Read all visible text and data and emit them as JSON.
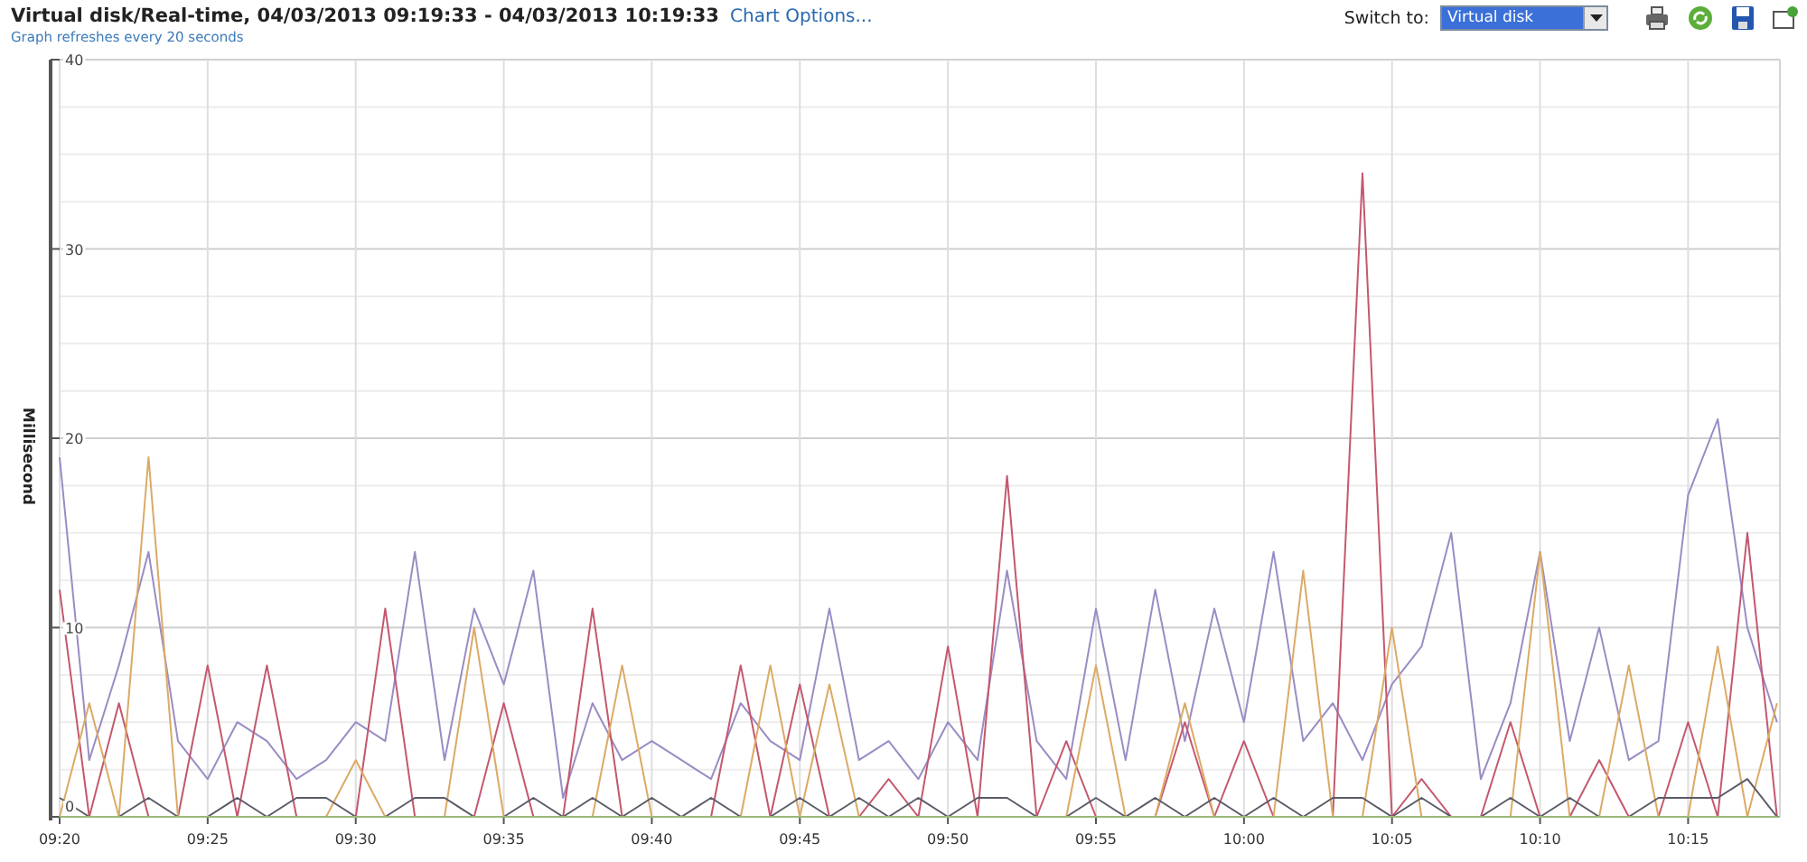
{
  "header": {
    "title": "Virtual disk/Real-time, 04/03/2013 09:19:33 - 04/03/2013 10:19:33",
    "chart_options_link": "Chart Options...",
    "subtitle": "Graph refreshes every 20 seconds",
    "switch_label": "Switch to:",
    "switch_value": "Virtual disk"
  },
  "chart": {
    "chart_data": {
      "type": "line",
      "ylabel": "Millisecond",
      "categories": [
        "09:20",
        null,
        null,
        null,
        null,
        "09:25",
        null,
        null,
        null,
        null,
        "09:30",
        null,
        null,
        null,
        null,
        "09:35",
        null,
        null,
        null,
        null,
        "09:40",
        null,
        null,
        null,
        null,
        "09:45",
        null,
        null,
        null,
        null,
        "09:50",
        null,
        null,
        null,
        null,
        "09:55",
        null,
        null,
        null,
        null,
        "10:00",
        null,
        null,
        null,
        null,
        "10:05",
        null,
        null,
        null,
        null,
        "10:10",
        null,
        null,
        null,
        null,
        "10:15",
        null,
        null,
        null
      ],
      "ylim": [
        0,
        40
      ],
      "grid": true,
      "yticks": [
        0,
        10,
        20,
        30,
        40
      ],
      "series": [
        {
          "color": "#9a8cc4",
          "values": [
            19,
            3,
            8,
            14,
            4,
            2,
            5,
            4,
            2,
            3,
            5,
            4,
            14,
            3,
            11,
            7,
            13,
            1,
            6,
            3,
            4,
            3,
            2,
            6,
            4,
            3,
            11,
            3,
            4,
            2,
            5,
            3,
            13,
            4,
            2,
            11,
            3,
            12,
            4,
            11,
            5,
            14,
            4,
            6,
            3,
            7,
            9,
            15,
            2,
            6,
            14,
            4,
            10,
            3,
            4,
            17,
            21,
            10,
            5
          ]
        },
        {
          "color": "#c4586e",
          "values": [
            12,
            0,
            6,
            0,
            0,
            8,
            0,
            8,
            0,
            0,
            0,
            11,
            0,
            0,
            0,
            6,
            0,
            0,
            11,
            0,
            0,
            0,
            0,
            8,
            0,
            7,
            0,
            0,
            2,
            0,
            9,
            0,
            18,
            0,
            4,
            0,
            0,
            0,
            5,
            0,
            4,
            0,
            0,
            0,
            34,
            0,
            2,
            0,
            0,
            5,
            0,
            0,
            3,
            0,
            0,
            5,
            0,
            15,
            0
          ]
        },
        {
          "color": "#dbaa66",
          "values": [
            0,
            6,
            0,
            19,
            0,
            0,
            0,
            0,
            0,
            0,
            3,
            0,
            0,
            0,
            10,
            0,
            0,
            0,
            0,
            8,
            0,
            0,
            0,
            0,
            8,
            0,
            7,
            0,
            0,
            0,
            0,
            0,
            0,
            0,
            0,
            8,
            0,
            0,
            6,
            0,
            0,
            0,
            13,
            0,
            0,
            10,
            0,
            0,
            0,
            0,
            14,
            0,
            0,
            8,
            0,
            0,
            9,
            0,
            6
          ]
        },
        {
          "color": "#5a5a68",
          "values": [
            1,
            0,
            0,
            1,
            0,
            0,
            1,
            0,
            1,
            1,
            0,
            0,
            1,
            1,
            0,
            0,
            1,
            0,
            1,
            0,
            1,
            0,
            1,
            0,
            0,
            1,
            0,
            1,
            0,
            1,
            0,
            1,
            1,
            0,
            0,
            1,
            0,
            1,
            0,
            1,
            0,
            1,
            0,
            1,
            1,
            0,
            1,
            0,
            0,
            1,
            0,
            1,
            0,
            0,
            1,
            1,
            1,
            2,
            0
          ]
        },
        {
          "color": "#9ab87a",
          "values": [
            0,
            0,
            0,
            0,
            0,
            0,
            0,
            0,
            0,
            0,
            0,
            0,
            0,
            0,
            0,
            0,
            0,
            0,
            0,
            0,
            0,
            0,
            0,
            0,
            0,
            0,
            0,
            0,
            0,
            0,
            0,
            0,
            0,
            0,
            0,
            0,
            0,
            0,
            0,
            0,
            0,
            0,
            0,
            0,
            0,
            0,
            0,
            0,
            0,
            0,
            0,
            0,
            0,
            0,
            0,
            0,
            0,
            0,
            0
          ]
        }
      ]
    }
  }
}
